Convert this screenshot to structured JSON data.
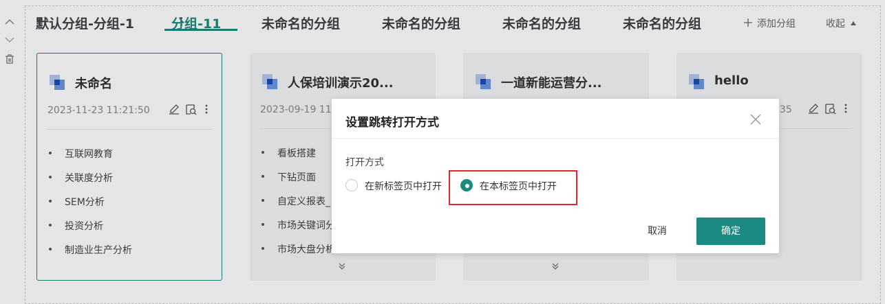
{
  "tabs": {
    "group_name": "默认分组-分组-1",
    "items": [
      {
        "label": "分组-11",
        "active": true
      },
      {
        "label": "未命名的分组",
        "active": false
      },
      {
        "label": "未命名的分组",
        "active": false
      },
      {
        "label": "未命名的分组",
        "active": false
      },
      {
        "label": "未命名的分组",
        "active": false
      }
    ],
    "add_group_label": "添加分组",
    "collapse_label": "收起"
  },
  "cards": [
    {
      "title": "未命名",
      "date": "2023-11-23 11:21:50",
      "items": [
        "互联网教育",
        "关联度分析",
        "SEM分析",
        "投资分析",
        "制造业生产分析"
      ]
    },
    {
      "title": "人保培训演示20...",
      "date": "2023-09-19 11",
      "items": [
        "看板搭建",
        "下钻页面",
        "自定义报表_",
        "市场关键词分",
        "市场大盘分析"
      ],
      "more": "(+)"
    },
    {
      "title": "一道新能运营分...",
      "date": "",
      "items": []
    },
    {
      "title": "hello",
      "date": "35",
      "items": []
    }
  ],
  "modal": {
    "title": "设置跳转打开方式",
    "field_label": "打开方式",
    "options": [
      {
        "label": "在新标签页中打开",
        "checked": false
      },
      {
        "label": "在本标签页中打开",
        "checked": true
      }
    ],
    "cancel_label": "取消",
    "ok_label": "确定"
  },
  "colors": {
    "accent": "#1a8a82",
    "highlight": "#e0282c"
  }
}
